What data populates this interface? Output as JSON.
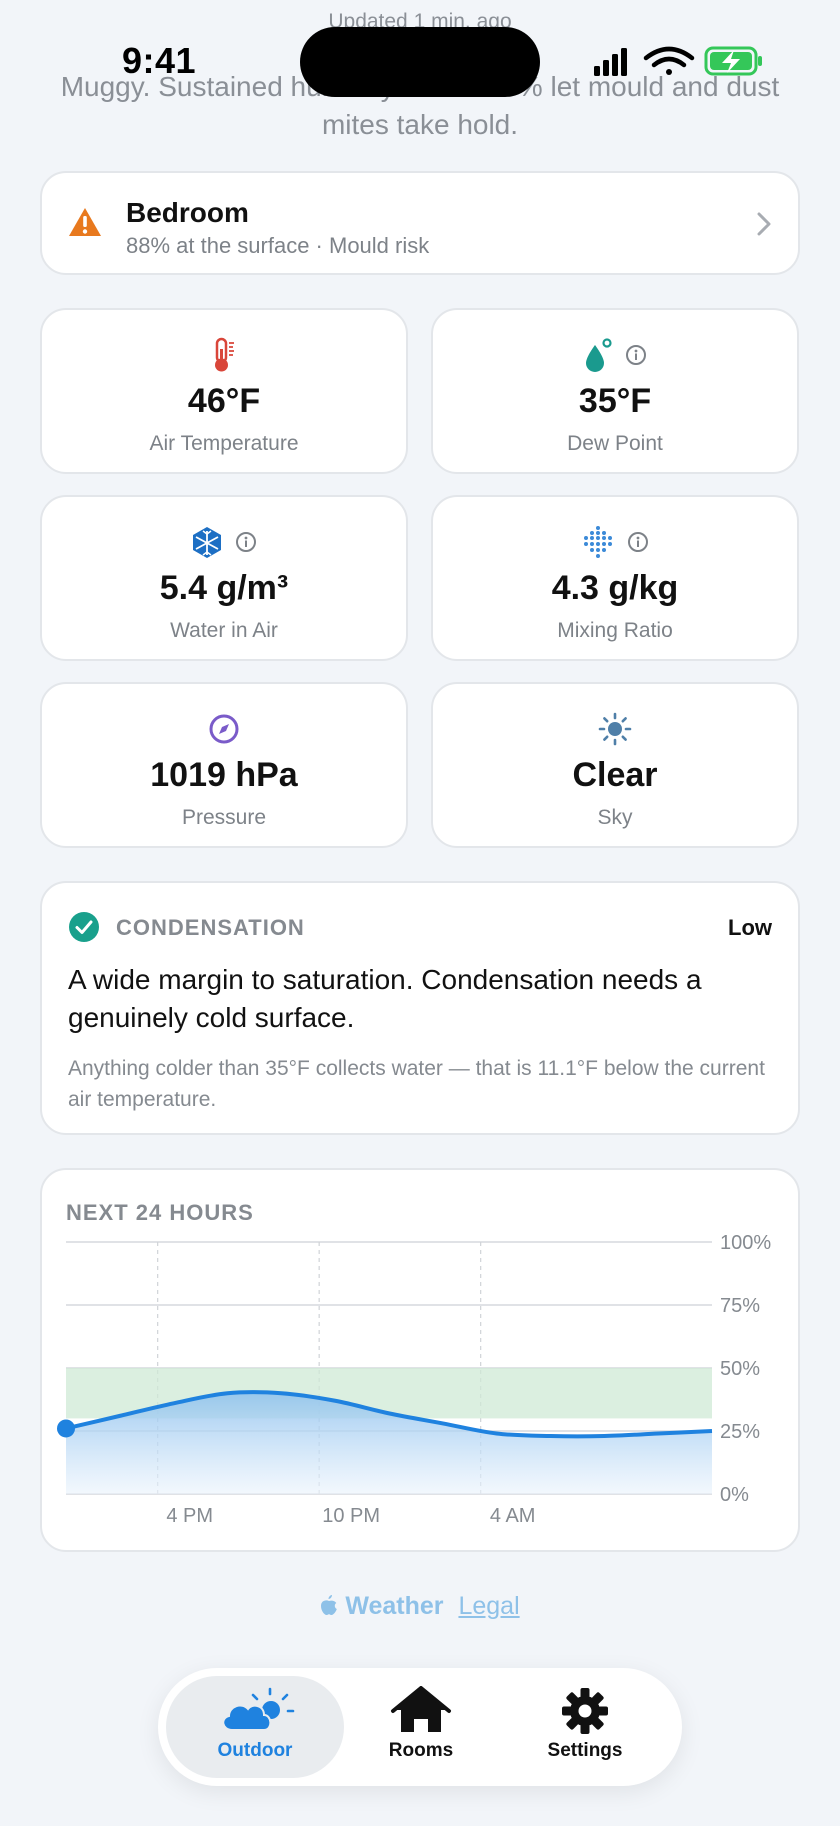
{
  "header": {
    "updated": "Updated 1 min. ago",
    "summary": "Muggy. Sustained humidity above 60% let mould and dust mites take hold."
  },
  "status_bar": {
    "time": "9:41"
  },
  "alert": {
    "title": "Bedroom",
    "subtitle": "88% at the surface · Mould risk",
    "color": "#e8791e"
  },
  "metrics": [
    {
      "value": "46°F",
      "label": "Air Temperature",
      "icon": "thermometer-icon",
      "color": "#d9463a"
    },
    {
      "value": "35°F",
      "label": "Dew Point",
      "icon": "droplet-icon",
      "color": "#1a9a8e"
    },
    {
      "value": "5.4 g/m³",
      "label": "Water in Air",
      "icon": "cube-icon",
      "color": "#1d6fc4"
    },
    {
      "value": "4.3 g/kg",
      "label": "Mixing Ratio",
      "icon": "dots-icon",
      "color": "#3c8ad8"
    },
    {
      "value": "1019 hPa",
      "label": "Pressure",
      "icon": "compass-icon",
      "color": "#7a5bc9"
    },
    {
      "value": "Clear",
      "label": "Sky",
      "icon": "sun-icon",
      "color": "#4f7fa8"
    }
  ],
  "condensation": {
    "title": "CONDENSATION",
    "level": "Low",
    "headline": "A wide margin to saturation. Condensation needs a genuinely cold surface.",
    "detail": "Anything colder than 35°F collects water — that is 11.1°F below the current air temperature.",
    "color": "#19a08c"
  },
  "chart": {
    "title": "NEXT 24 HOURS",
    "y_ticks": [
      "100%",
      "75%",
      "50%",
      "25%",
      "0%"
    ],
    "x_ticks": [
      "4 PM",
      "10 PM",
      "4 AM"
    ]
  },
  "chart_data": {
    "type": "area",
    "title": "NEXT 24 HOURS",
    "xlabel": "",
    "ylabel": "",
    "ylim": [
      0,
      100
    ],
    "x_hours": [
      0,
      2,
      4,
      6,
      8,
      10,
      12,
      14,
      16,
      18,
      20,
      22,
      24
    ],
    "categories": [
      "4 PM",
      "10 PM",
      "4 AM"
    ],
    "series": [
      {
        "values": [
          26,
          31,
          36,
          40,
          40,
          37,
          32,
          28,
          24,
          23,
          23,
          24,
          25
        ]
      }
    ],
    "comfort_band": [
      30,
      50
    ],
    "color": "#1f82df",
    "band_color": "#cfe9d6"
  },
  "footer": {
    "brand": "Weather",
    "legal": "Legal"
  },
  "tabs": [
    {
      "label": "Outdoor",
      "active": true
    },
    {
      "label": "Rooms",
      "active": false
    },
    {
      "label": "Settings",
      "active": false
    }
  ]
}
